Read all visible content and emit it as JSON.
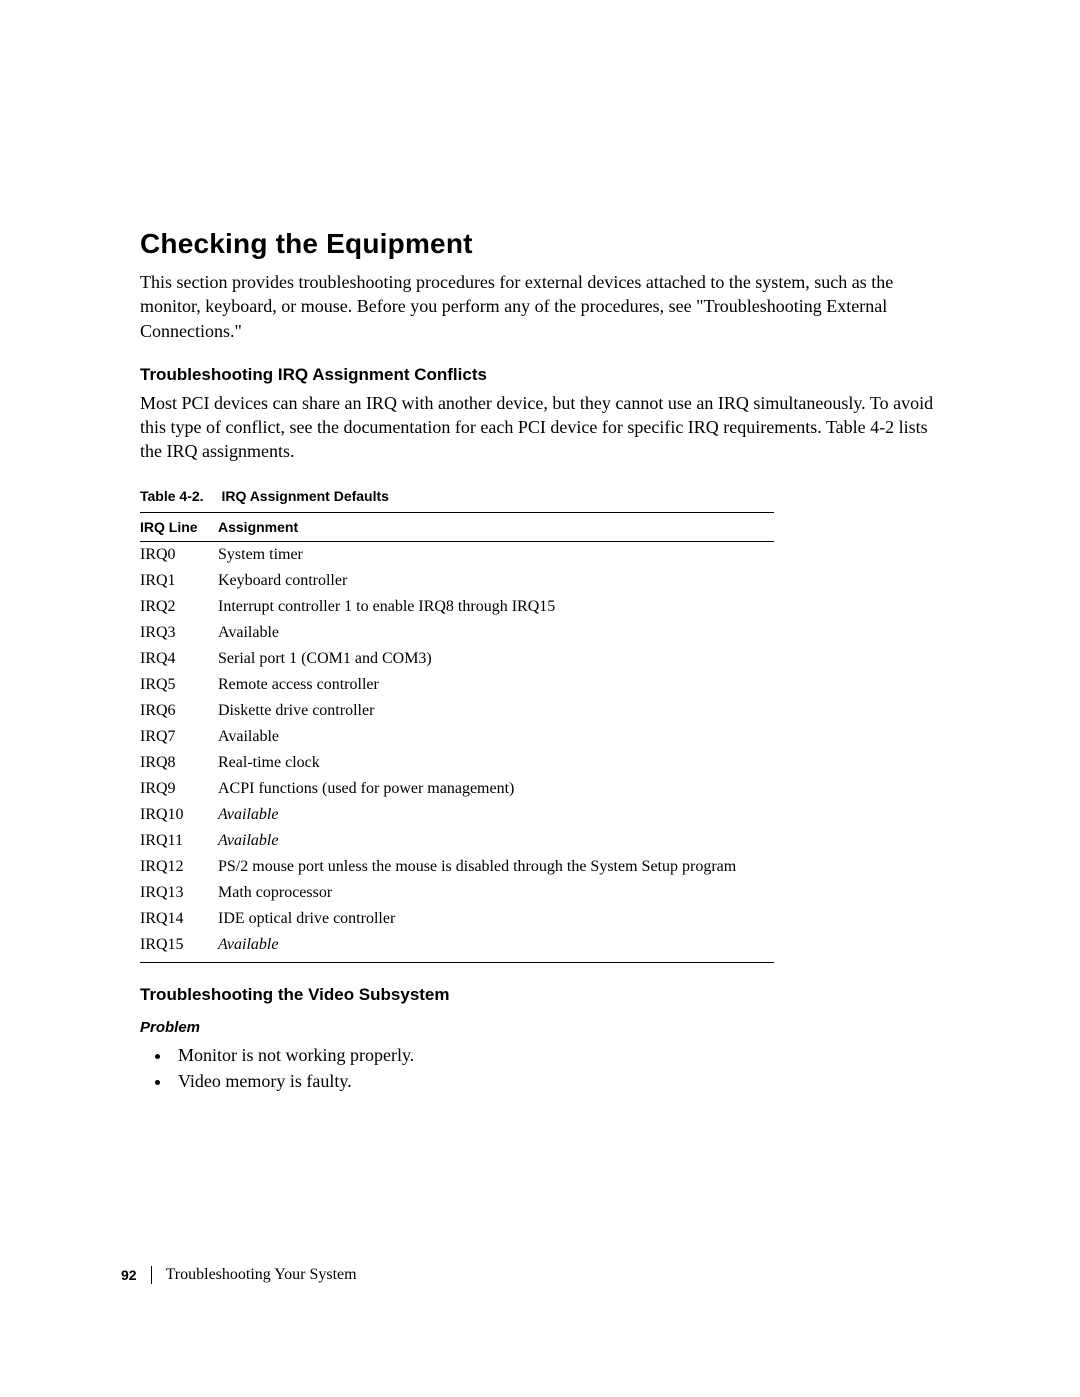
{
  "heading": "Checking the Equipment",
  "intro": "This section provides troubleshooting procedures for external devices attached to the system, such as the monitor, keyboard, or mouse. Before you perform any of the procedures, see \"Troubleshooting External Connections.\"",
  "subheading1": "Troubleshooting IRQ Assignment Conflicts",
  "para1": "Most PCI devices can share an IRQ with another device, but they cannot use an IRQ simultaneously. To avoid this type of conflict, see the documentation for each PCI device for specific IRQ requirements. Table 4-2 lists the IRQ assignments.",
  "table": {
    "caption_label": "Table 4-2.",
    "caption_title": "IRQ Assignment Defaults",
    "headers": {
      "col1": "IRQ Line",
      "col2": "Assignment"
    },
    "rows": [
      {
        "irq": "IRQ0",
        "assignment": "System timer",
        "italic": false
      },
      {
        "irq": "IRQ1",
        "assignment": "Keyboard controller",
        "italic": false
      },
      {
        "irq": "IRQ2",
        "assignment": "Interrupt controller 1 to enable IRQ8 through IRQ15",
        "italic": false
      },
      {
        "irq": "IRQ3",
        "assignment": "Available",
        "italic": false
      },
      {
        "irq": "IRQ4",
        "assignment": "Serial port 1 (COM1 and COM3)",
        "italic": false
      },
      {
        "irq": "IRQ5",
        "assignment": "Remote access controller",
        "italic": false
      },
      {
        "irq": "IRQ6",
        "assignment": "Diskette drive controller",
        "italic": false
      },
      {
        "irq": "IRQ7",
        "assignment": "Available",
        "italic": false
      },
      {
        "irq": "IRQ8",
        "assignment": "Real-time clock",
        "italic": false
      },
      {
        "irq": "IRQ9",
        "assignment": "ACPI functions (used for power management)",
        "italic": false
      },
      {
        "irq": "IRQ10",
        "assignment": "Available",
        "italic": true
      },
      {
        "irq": "IRQ11",
        "assignment": "Available",
        "italic": true
      },
      {
        "irq": "IRQ12",
        "assignment": "PS/2 mouse port unless the mouse is disabled through the System Setup program",
        "italic": false
      },
      {
        "irq": "IRQ13",
        "assignment": "Math coprocessor",
        "italic": false
      },
      {
        "irq": "IRQ14",
        "assignment": "IDE optical drive controller",
        "italic": false
      },
      {
        "irq": "IRQ15",
        "assignment": "Available",
        "italic": true
      }
    ]
  },
  "subheading2": "Troubleshooting the Video Subsystem",
  "problem_heading": "Problem",
  "problems": [
    "Monitor is not working properly.",
    "Video memory is faulty."
  ],
  "footer": {
    "page_number": "92",
    "section_title": "Troubleshooting Your System"
  }
}
